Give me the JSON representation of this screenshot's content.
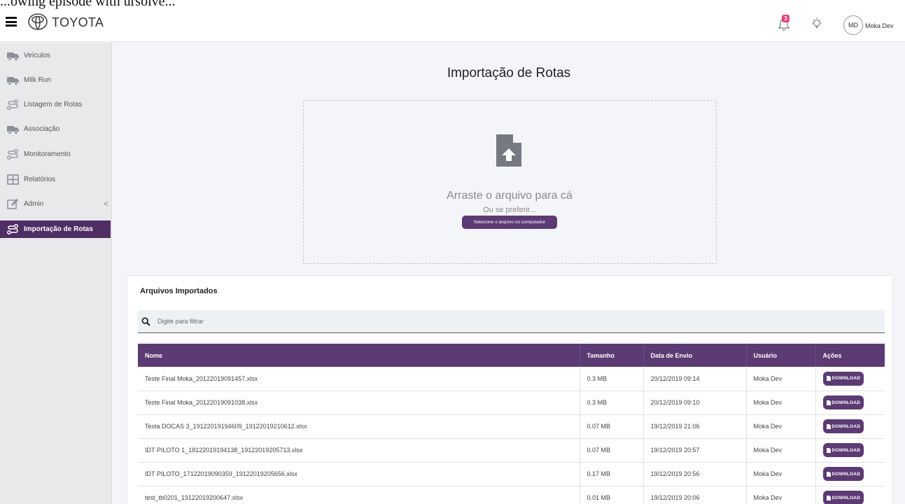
{
  "cropped_text": "...owing episode with ursolve...",
  "topbar": {
    "brand": "TOYOTA",
    "notification_count": "3",
    "user_initials": "MD",
    "user_name": "Moka Dev"
  },
  "sidebar": {
    "items": [
      {
        "label": "Veículos",
        "icon": "truck-icon"
      },
      {
        "label": "Milk Run",
        "icon": "truck-icon"
      },
      {
        "label": "Listagem de Rotas",
        "icon": "route-icon"
      },
      {
        "label": "Associação",
        "icon": "truck-icon"
      },
      {
        "label": "Monitoramento",
        "icon": "route-icon"
      },
      {
        "label": "Relatórios",
        "icon": "grid-icon"
      },
      {
        "label": "Admin",
        "icon": "edit-icon",
        "chevron": "<"
      },
      {
        "label": "Importação de Rotas",
        "icon": "route-icon",
        "active": true
      }
    ]
  },
  "main": {
    "title": "Importação de Rotas",
    "dropzone": {
      "title": "Arraste o arquivo para cá",
      "subtitle": "Ou se preferir...",
      "button": "Selecione o arquivo no computador"
    }
  },
  "imports": {
    "title": "Arquivos Importados",
    "filter_placeholder": "Digite para filtrar",
    "columns": [
      "Nome",
      "Tamanho",
      "Data de Envio",
      "Usuário",
      "Ações"
    ],
    "download_label": "DOWNLOAD",
    "rows": [
      {
        "name": "Teste Final Moka_20122019091457.xlsx",
        "size": "0.3 MB",
        "date": "20/12/2019 09:14",
        "user": "Moka Dev"
      },
      {
        "name": "Teste Final Moka_20122019091038.xlsx",
        "size": "0.3 MB",
        "date": "20/12/2019 09:10",
        "user": "Moka Dev"
      },
      {
        "name": "Testa DOCAS 3_19122019194609_19122019210612.xlsx",
        "size": "0.07 MB",
        "date": "19/12/2019 21:06",
        "user": "Moka Dev"
      },
      {
        "name": "IDT PILOTO 1_18122019194138_19122019205713.xlsx",
        "size": "0.07 MB",
        "date": "19/12/2019 20:57",
        "user": "Moka Dev"
      },
      {
        "name": "IDT PILOTO_17122019090359_19122019205656.xlsx",
        "size": "0.17 MB",
        "date": "19/12/2019 20:56",
        "user": "Moka Dev"
      },
      {
        "name": "test_tb0201_19122019200647.xlsx",
        "size": "0.01 MB",
        "date": "19/12/2019 20:06",
        "user": "Moka Dev"
      }
    ]
  },
  "colors": {
    "accent": "#5c3a74",
    "active_nav": "#4f2e65",
    "badge": "#e6417a",
    "background": "#f4f5f9"
  }
}
